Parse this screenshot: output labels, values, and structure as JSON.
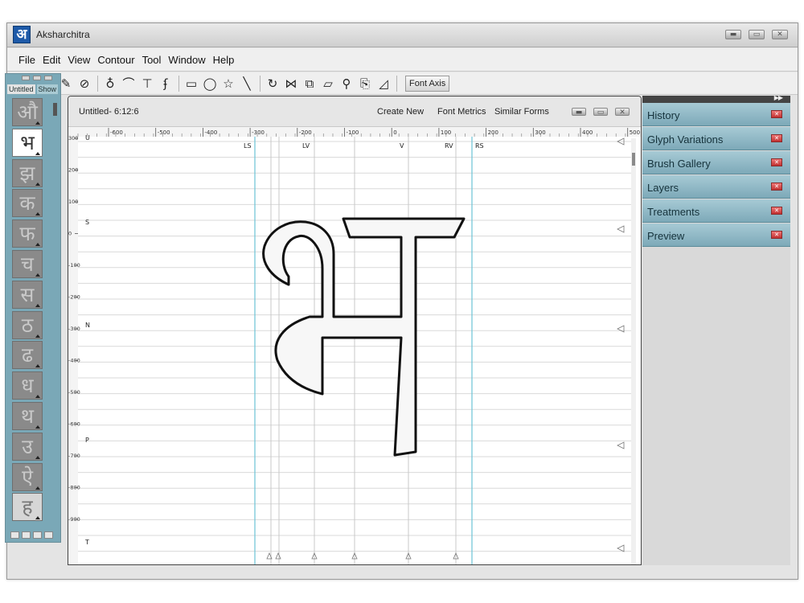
{
  "app": {
    "title": "Aksharchitra",
    "logo_glyph": "अ"
  },
  "menu": [
    "File",
    "Edit",
    "View",
    "Contour",
    "Tool",
    "Window",
    "Help"
  ],
  "toolbar": {
    "tools": [
      "arrow-icon",
      "hand-icon",
      "eraser-icon",
      "ruler-icon",
      "pen-icon",
      "curve-icon",
      "t-joint-icon",
      "hook-icon",
      "rectangle-icon",
      "ellipse-icon",
      "star-icon",
      "line-icon",
      "rotate-icon",
      "mirror-icon",
      "scale-icon",
      "skew-icon",
      "zoom-icon",
      "copy-icon",
      "corner-icon"
    ],
    "font_axis_label": "Font Axis"
  },
  "glyph_panel": {
    "tab_untitled": "Untitled",
    "tab_show": "Show",
    "glyphs": [
      "औ",
      "भ",
      "झ",
      "क",
      "फ",
      "च",
      "स",
      "ठ",
      "ढ",
      "ध",
      "थ",
      "उ",
      "ऐ",
      "ह"
    ],
    "selected_index": 1
  },
  "document": {
    "title": "Untitled- 6:12:6",
    "create_new": "Create New",
    "font_metrics": "Font Metrics",
    "similar_forms": "Similar Forms"
  },
  "canvas": {
    "ruler_top": [
      "-600",
      "-500",
      "-400",
      "-300",
      "-200",
      "-100",
      "0",
      "100",
      "200",
      "300",
      "400",
      "500"
    ],
    "ruler_left": [
      "300",
      "200",
      "100",
      "0",
      "-100",
      "-200",
      "-300",
      "-400",
      "-500",
      "-600",
      "-700",
      "-800",
      "-900"
    ],
    "guide_labels_top": [
      "LS",
      "LV",
      "V",
      "RV",
      "RS"
    ],
    "guide_labels_left": [
      "U",
      "S",
      "N",
      "P",
      "T"
    ],
    "glyph": "भ"
  },
  "right_panels": [
    "History",
    "Glyph Variations",
    "Brush Gallery",
    "Layers",
    "Treatments",
    "Preview"
  ],
  "colors": {
    "panel_blue": "#7aa8b7",
    "guide_cyan": "#6cc3d6",
    "close_red": "#c13030"
  }
}
